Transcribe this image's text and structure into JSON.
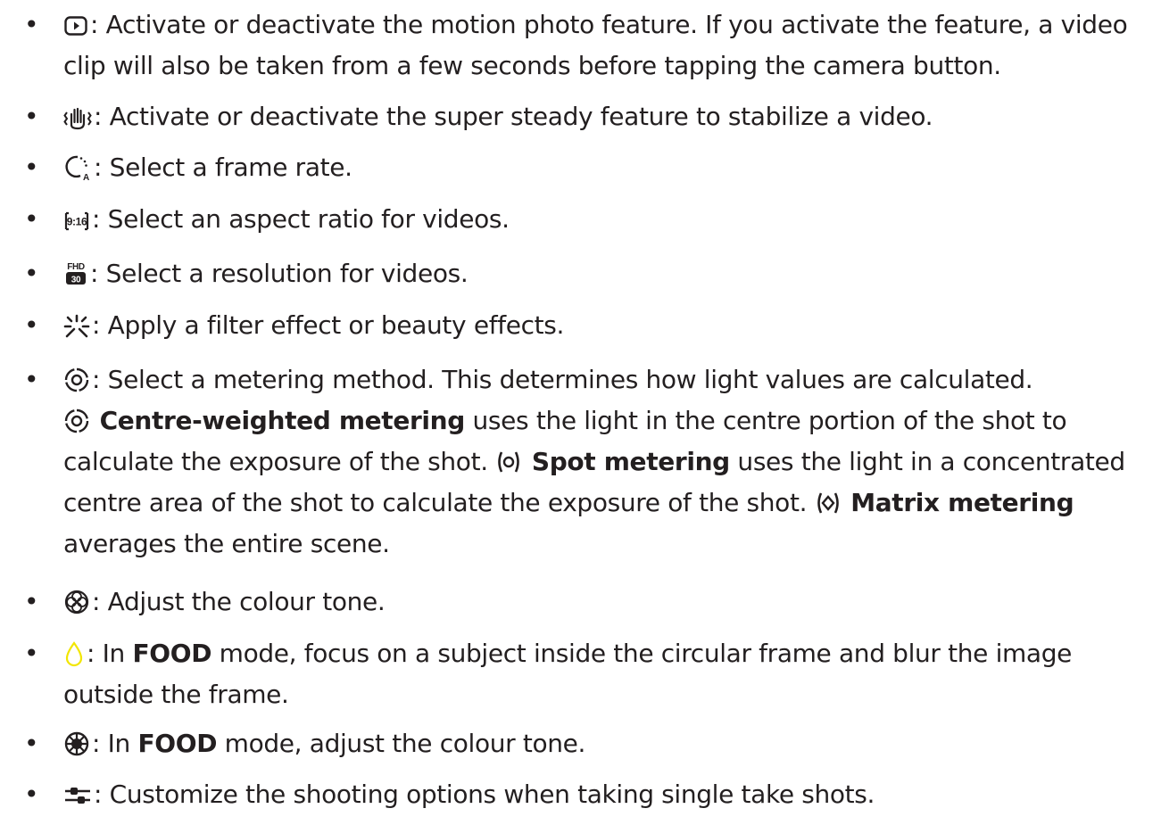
{
  "colors": {
    "text": "#231f20",
    "accent_yellow": "#f2e600"
  },
  "items": [
    {
      "icon": "motion-photo-icon",
      "lines": [
        "Activate or deactivate the motion photo feature. If you activate the feature, a video",
        "clip will also be taken from a few seconds before tapping the camera button."
      ]
    },
    {
      "icon": "super-steady-icon",
      "lines": [
        "Activate or deactivate the super steady feature to stabilize a video."
      ]
    },
    {
      "icon": "frame-rate-icon",
      "lines": [
        "Select a frame rate."
      ]
    },
    {
      "icon": "aspect-ratio-icon",
      "icon_text": "9:16",
      "lines": [
        "Select an aspect ratio for videos."
      ]
    },
    {
      "icon": "resolution-icon",
      "icon_text_top": "FHD",
      "icon_text_bottom": "30",
      "lines": [
        "Select a resolution for videos."
      ]
    },
    {
      "icon": "filter-icon",
      "lines": [
        "Apply a filter effect or beauty effects."
      ]
    },
    {
      "icon": "metering-icon",
      "lines": [
        "Select a metering method. This determines how light values are calculated."
      ],
      "centre_bold": "Centre-weighted metering",
      "centre_rest": "uses the light in the centre portion of the shot to",
      "line3": "calculate the exposure of the shot.",
      "spot_bold": "Spot metering",
      "spot_rest": "uses the light in a concentrated",
      "line4": "centre area of the shot to calculate the exposure of the shot.",
      "matrix_bold": "Matrix metering",
      "line5": "averages the entire scene."
    },
    {
      "icon": "colour-tone-icon",
      "lines": [
        "Adjust the colour tone."
      ]
    },
    {
      "icon": "focus-blur-icon",
      "pre": "In",
      "bold": "FOOD",
      "post": "mode, focus on a subject inside the circular frame and blur the image",
      "line2": "outside the frame."
    },
    {
      "icon": "food-colour-tone-icon",
      "pre": "In",
      "bold": "FOOD",
      "post": "mode, adjust the colour tone."
    },
    {
      "icon": "single-take-options-icon",
      "lines": [
        "Customize the shooting options when taking single take shots."
      ]
    }
  ]
}
